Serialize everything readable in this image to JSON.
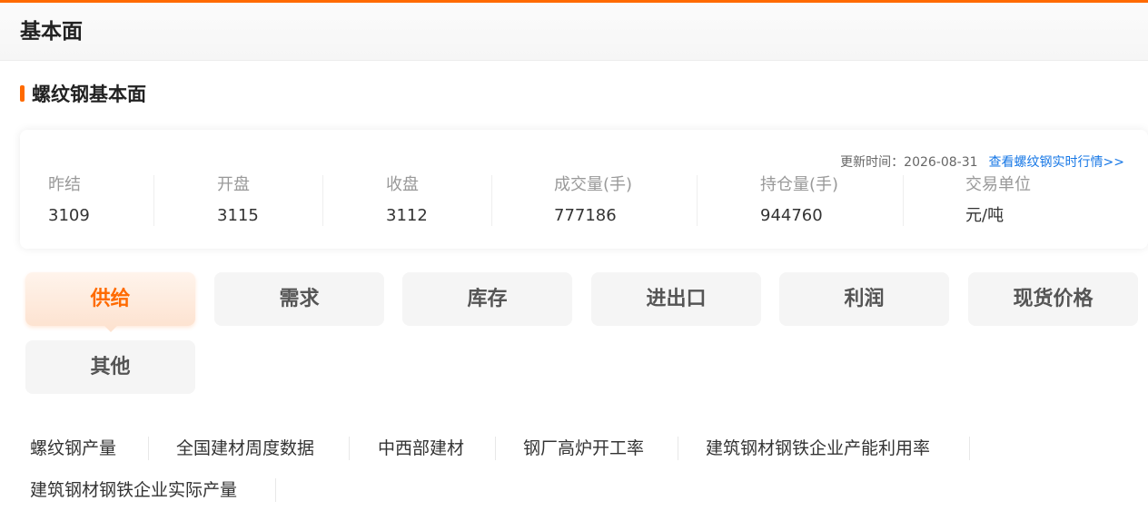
{
  "header": {
    "title": "基本面"
  },
  "section": {
    "title": "螺纹钢基本面"
  },
  "quote": {
    "update_label": "更新时间：",
    "update_date": "2026-08-31",
    "realtime_link": "查看螺纹钢实时行情>>",
    "stats": [
      {
        "label": "昨结",
        "value": "3109"
      },
      {
        "label": "开盘",
        "value": "3115"
      },
      {
        "label": "收盘",
        "value": "3112"
      },
      {
        "label": "成交量(手)",
        "value": "777186"
      },
      {
        "label": "持仓量(手)",
        "value": "944760"
      },
      {
        "label": "交易单位",
        "value": "元/吨"
      }
    ]
  },
  "tabs": [
    {
      "label": "供给",
      "active": true
    },
    {
      "label": "需求"
    },
    {
      "label": "库存"
    },
    {
      "label": "进出口"
    },
    {
      "label": "利润"
    },
    {
      "label": "现货价格"
    },
    {
      "label": "其他"
    }
  ],
  "sub_links": [
    "螺纹钢产量",
    "全国建材周度数据",
    "中西部建材",
    "钢厂高炉开工率",
    "建筑钢材钢铁企业产能利用率",
    "建筑钢材钢铁企业实际产量"
  ],
  "colors": {
    "accent": "#ff6a00",
    "link": "#1677e6"
  }
}
